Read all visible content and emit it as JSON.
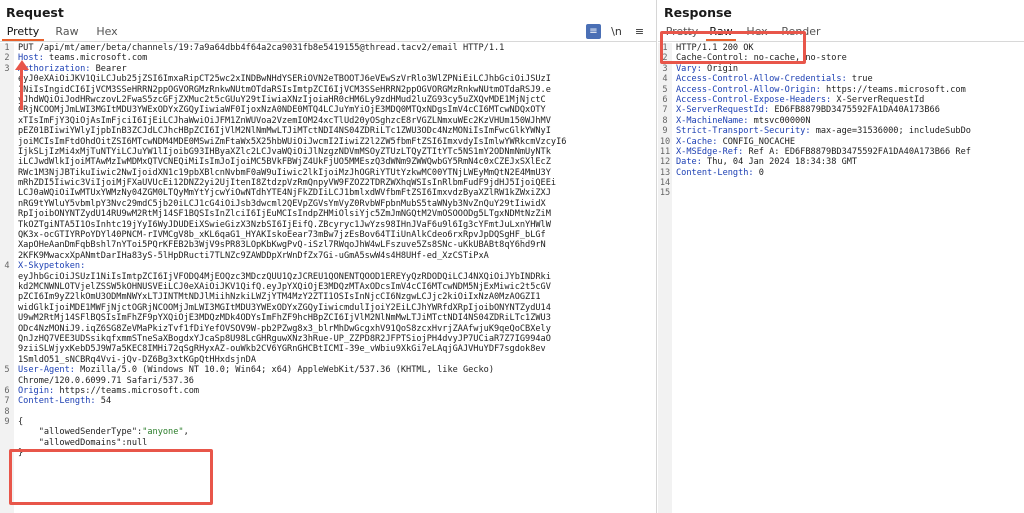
{
  "request": {
    "title": "Request",
    "tabs": [
      "Pretty",
      "Raw",
      "Hex"
    ],
    "tools": {
      "wrap": "≡",
      "newline": "\\n",
      "menu": "≡"
    },
    "lines": [
      {
        "n": "1",
        "t": "PUT /api/mt/amer/beta/channels/19:7a9a64dbb4f64a2ca9031fb8e5419155@thread.tacv2/email HTTP/1.1"
      },
      {
        "n": "2",
        "k": "Host: ",
        "t": "teams.microsoft.com"
      },
      {
        "n": "3",
        "k": "Authorization: ",
        "t": "Bearer"
      },
      {
        "n": "",
        "t": "eyJ0eXAiOiJKV1QiLCJub25jZSI6ImxaRipCT25wc2xINDBwNHdYSERiOVN2eTBOOTJ6eVEwSzVrRlo3WlZPNiEiLCJhbGciOiJSUzI"
      },
      {
        "n": "",
        "t": "1NiIsIngidCI6IjVCM3SSeHRRN2ppOGVORGMzRnkwNUtmOTdaRSIsImtpZCI6IjVCM3SSeHRRN2ppOGVORGMzRnkwNUtmOTdaRSJ9.e"
      },
      {
        "n": "",
        "t": "yJhdWQiOiJodHRwczovL2FwaS5zcGFjZXMuc2t5cGUuY29tIiwiaXNzIjoiaHR0cHM6Ly9zdHMud2luZG93cy5uZXQvMDE1MjNjctC"
      },
      {
        "n": "",
        "t": "CRjNCOOMjJmLWI3MGItMDU3YWExODYxZGQyIiwiaWF0IjoxNzA0NDE0MTQ4LCJuYmYiOjE3MDQ0MTQxNDgsImV4cCI6MTcwNDQxOTY"
      },
      {
        "n": "",
        "t": "xTIsImFjY3QiOjAsImFjciI6IjEiLCJhaWwiOiJFM1ZnWUVoa2VzemIOM24xcTlUd20yOSghzcE8rVGZLNmxuWEc2KzVHUm150WJhMV"
      },
      {
        "n": "",
        "t": "pEZ01BIiwiYWlyIjpbInB3ZCJdLCJhcHBpZCI6IjVlM2NlNmMwLTJiMTctNDI4NS04ZDRiLTc1ZWU3ODc4NzMONiIsImFwcGlkYWNyI"
      },
      {
        "n": "",
        "t": "joiMCIsImFtdOhdOitZSI6MTcwNDM4MDE0MSwiZmFtaWx5X25hbWUiOiJwcmI2IiwiZ2l2ZW5fbmFtZSI6ImxvdyIsImlwYWRkcmVzcyI6"
      },
      {
        "n": "",
        "t": "IjkSLjIzMi4xMjTuNTYiLCJuYW1lIjoibG93IHByaXZlc2LCJvaWQiOiJlNzgzNDVmMSOyZTUzLTQyZTItYTc5NS1mY2ODNmNmUyNTk"
      },
      {
        "n": "",
        "t": "iLCJwdWlkIjoiMTAwMzIwMDMxQTVCNEQiMiIsImJoIjoiMC5BVkFBWjZ4UkFjUO5MMEszQ3dWNm9ZWWQwbGY5RmN4c0xCZEJxSXlEcZ"
      },
      {
        "n": "",
        "t": "RWc1M3NjJBTikuIiwic2NwIjoidXN1c19pbXBlcnNvbmF0aW9uIiwic2lkIjoiMzJhOGRiYTUtYzkwMC00YTNjLWEyMmQtN2E4MmU3Y"
      },
      {
        "n": "",
        "t": "mRhZDI5Iiwic3ViIjoiMjFXaUVUcEi12DNZ2yi2UjItenI8ZtdzpVzRmQnpyVW9FZOZ2TDRZWXhqWSIsInRlbmFudF9jdHJ5IjoiQEEi"
      },
      {
        "n": "",
        "t": "LCJ0aWQiOiIwMTUxYWMzNy04ZGM0LTQyMmYtYjcwYiOwNTdhYTE4NjFkZDIiLCJ1bmlxdWVfbmFtZSI6ImxvdzByaXZlRW1kZWxiZXJ"
      },
      {
        "n": "",
        "t": "nRG9tYWluY5vbmlpY3Nvc29mdC5jb20iLCJ1cG4iOiJsb3dwcml2QEVpZGVsYmVyZ0RvbWFpbnMubS5taWNyb3NvZnQuY29tIiwidX"
      },
      {
        "n": "",
        "t": "RpIjoibONYNTZydU14RU9wM2RtMj14SF1BQSIsInZlciI6IjEuMCIsIndpZHMiOlsiYjc5ZmJmNGQtM2VmOSOOODg5LTgxNDMtNzZiM"
      },
      {
        "n": "",
        "t": "TkOZTgiNTA5I1OsInhtc19jYyI6WyJDUDEiXSwieGizX3NzbSI6IjEifQ.ZBcyryc1JwYzs98IHnJVaF6u9l6Ig3cYFmtJuLxnYHWlW"
      },
      {
        "n": "",
        "t": "QK3x-ocGTIYRPoYDYl40PNCM-rIVMCgV8b_xKL6qaG1_HYAKIskoEear73mBw7jzEsBov64TIiUnAlkCdeo6rxRpvJpDQSgHF_bLGf"
      },
      {
        "n": "",
        "t": "XapOHeAanDmFqbBshl7nYToi5PQrKFEB2b3WjV9sPR83LOpKbKwgPvQ-iSzl7RWqoJhW4wLFszuve5Zs8SNc-uKkUBABt8qY6hd9rN"
      },
      {
        "n": "",
        "t": "2KFK9MwacxXpANmtDarIHa83yS-5lHpDRucti7TLNZc9ZAWDDpXrWnDfZx7Gi-uGmA5swW4s4H8UHf-ed_XzCSTiPxA"
      },
      {
        "n": "4",
        "k": "X-Skypetoken:",
        "t": ""
      },
      {
        "n": "",
        "t": "eyJhbGciOiJSUzI1NiIsImtpZCI6IjVFODQ4MjEOQzc3MDczQUU1QzJCREU1QONENTQOOD1EREYyQzRDODQiLCJ4NXQiOiJYbINDRki"
      },
      {
        "n": "",
        "t": "kd2MCNWNLOTVjelZSSW5kOHNUSVEiLCJ0eXAiOiJKV1QifQ.eyJpYXQiOjE3MDQzMTAxODcsImV4cCI6MTcwNDM5NjExMiwic2t5cGV"
      },
      {
        "n": "",
        "t": "pZCI6Im9yZ2lkOmU3ODMmNWYxLTJINTMtNDJlMiihNzkiLWZjYTM4MzY2ZTI1OSIsInNjcCI6NzgwLCJjc2kiOiIxNzA0MzAOGZI1"
      },
      {
        "n": "",
        "t": "widGlkIjoiMDE1MWFjNjctOGRjNCOOMjJmLWI3MGItMDU3YWExODYxZGQyIiwicmdulIjoiY2EiLCJhYWRfdXRpIjoibONYNTZydU14"
      },
      {
        "n": "",
        "t": "U9wM2RtMj14SFlBQSIsImFhZF9pYXQiOjE3MDQzMDk4ODYsImFhZF9hcHBpZCI6IjVlM2NlNmMwLTJiMTctNDI4NS04ZDRiLTc1ZWU3"
      },
      {
        "n": "",
        "t": "ODc4NzMONiJ9.iqZ6SG8ZeVMaPkizTvf1fDiYefOVSOV9W-pb2PZwg8x3_blrMhDwGcgxhV91QoS8zcxHvrjZAAfwjuK9qeQoCBXely"
      },
      {
        "n": "",
        "t": "QnJzHQ7VEE3UDSsikqfxmmSTneSaXBogdxYJcaSp8U98LcGHRguwXNz3hRue-UP_ZZPD8R2JFPTSiojPH4dvyJP7UCiaR7Z7IG994aO"
      },
      {
        "n": "",
        "t": "9ziiSLWjyxKebD5J9W7a5KEC8IMHi72qSgRHyxAZ-ouWkb2CV6YGRnGHCBtICMI-39e_vWbiu9XkGi7eLAqjGAJVHuYDF7sgdok8ev"
      },
      {
        "n": "",
        "t": "1SmldO51_sNCBRq4Vvi-jQv-DZ6Bg3xtKGpQtHHxdsjnDA"
      },
      {
        "n": "5",
        "k": "User-Agent: ",
        "t": "Mozilla/5.0 (Windows NT 10.0; Win64; x64) AppleWebKit/537.36 (KHTML, like Gecko)"
      },
      {
        "n": "",
        "t": "Chrome/120.0.6099.71 Safari/537.36"
      },
      {
        "n": "6",
        "k": "Origin: ",
        "t": "https://teams.microsoft.com"
      },
      {
        "n": "7",
        "k": "Content-Length: ",
        "t": "54"
      },
      {
        "n": "8",
        "t": ""
      },
      {
        "n": "9",
        "t": "{"
      },
      {
        "n": "",
        "t": "    \"allowedSenderType\":",
        "s": "\"anyone\"",
        "e": ","
      },
      {
        "n": "",
        "t": "    \"allowedDomains\":null"
      },
      {
        "n": "",
        "t": "}"
      }
    ]
  },
  "response": {
    "title": "Response",
    "tabs": [
      "Pretty",
      "Raw",
      "Hex",
      "Render"
    ],
    "lines": [
      {
        "n": "1",
        "t": "HTTP/1.1 200 OK"
      },
      {
        "n": "2",
        "t": "Cache-Control: no-cache, no-store"
      },
      {
        "n": "3",
        "k": "Vary: ",
        "t": "Origin"
      },
      {
        "n": "4",
        "k": "Access-Control-Allow-Credentials: ",
        "t": "true"
      },
      {
        "n": "5",
        "k": "Access-Control-Allow-Origin: ",
        "t": "https://teams.microsoft.com"
      },
      {
        "n": "6",
        "k": "Access-Control-Expose-Headers: ",
        "t": "X-ServerRequestId"
      },
      {
        "n": "7",
        "k": "X-ServerRequestId: ",
        "t": "ED6FB8879BD3475592FA1DA40A173B66"
      },
      {
        "n": "8",
        "k": "X-MachineName: ",
        "t": "mtsvc00000N"
      },
      {
        "n": "9",
        "k": "Strict-Transport-Security: ",
        "t": "max-age=31536000; includeSubDo"
      },
      {
        "n": "10",
        "k": "X-Cache: ",
        "t": "CONFIG_NOCACHE"
      },
      {
        "n": "11",
        "k": "X-MSEdge-Ref: ",
        "t": "Ref A: ED6FB8879BD3475592FA1DA40A173B66 Ref"
      },
      {
        "n": "12",
        "k": "Date: ",
        "t": "Thu, 04 Jan 2024 18:34:38 GMT"
      },
      {
        "n": "13",
        "k": "Content-Length: ",
        "t": "0"
      },
      {
        "n": "14",
        "t": ""
      },
      {
        "n": "15",
        "t": ""
      }
    ]
  }
}
